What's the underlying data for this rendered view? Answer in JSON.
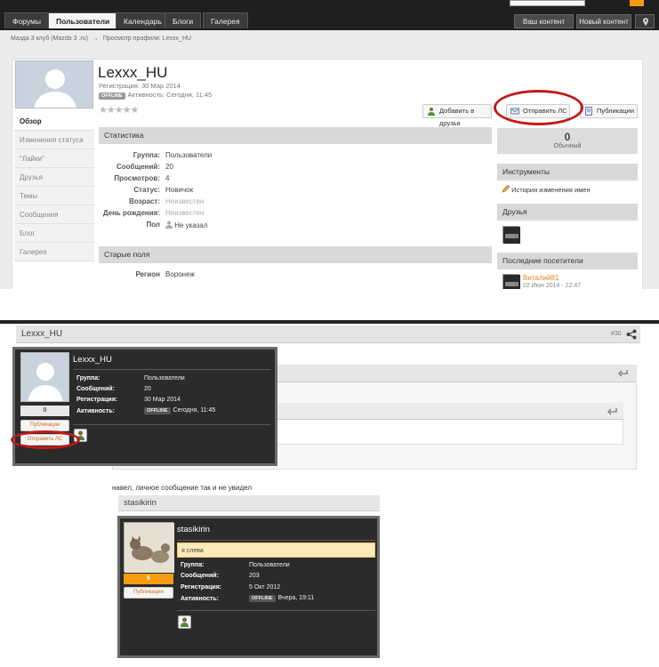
{
  "shot1": {
    "nav": {
      "tabs": [
        "Форумы",
        "Пользователи",
        "Календарь",
        "Блоги",
        "Галерея"
      ],
      "active_index": 1,
      "right_buttons": [
        "Ваш контент",
        "Новый контент"
      ]
    },
    "breadcrumb": {
      "site": "Мазда 3 клуб (Mazda 3 .ru)",
      "sep": "→",
      "page": "Просмотр профиля: Lexxx_HU"
    },
    "profile": {
      "username": "Lexxx_HU",
      "registered": "Регистрация: 30 Мар 2014",
      "status_badge": "OFFLINE",
      "activity": "Активность: Сегодня, 11:45",
      "rating_stars": 5,
      "buttons": {
        "add_friend": "Добавить в друзья",
        "send_pm": "Отправить ЛС",
        "publications": "Публикации"
      }
    },
    "sidebar": [
      "Обзор",
      "Изменения статуса",
      "\"Лайки\"",
      "Друзья",
      "Темы",
      "Сообщения",
      "Блог",
      "Галерея"
    ],
    "stats": {
      "heading": "Статистика",
      "rows": [
        {
          "k": "Группа:",
          "v": "Пользователи"
        },
        {
          "k": "Сообщений:",
          "v": "20"
        },
        {
          "k": "Просмотров:",
          "v": "4"
        },
        {
          "k": "Статус:",
          "v": "Новичок"
        },
        {
          "k": "Возраст:",
          "v": "Неизвестен"
        },
        {
          "k": "День рождения:",
          "v": "Неизвестен"
        },
        {
          "k": "Пол",
          "v": "Не указал"
        }
      ]
    },
    "old_fields": {
      "heading": "Старые поля",
      "region_k": "Регион",
      "region_v": "Воронеж"
    },
    "reputation": {
      "value": "0",
      "label": "Обычный"
    },
    "tools": {
      "heading": "Инструменты",
      "item": "История изменения имен"
    },
    "friends": {
      "heading": "Друзья"
    },
    "visitors": {
      "heading": "Последние посетители",
      "name": "Виталий81",
      "date": "02 Июн 2014 - 22:47"
    }
  },
  "shot2": {
    "post_author": "Lexxx_HU",
    "post_number": "#30",
    "card1": {
      "name": "Lexxx_HU",
      "rep": "0",
      "pub_btn": "Публикации",
      "pm_btn": "Отправить ЛС",
      "rows": [
        {
          "k": "Группа:",
          "v": "Пользователи"
        },
        {
          "k": "Сообщений:",
          "v": "20"
        },
        {
          "k": "Регистрация:",
          "v": "30 Мар 2014"
        },
        {
          "k": "Активность:",
          "badge": "OFFLINE",
          "v": "Сегодня, 11:45"
        }
      ]
    },
    "message_text": "навел, личное сообщение так и не увидел",
    "quote_author": "stasikirin",
    "card2": {
      "name": "stasikirin",
      "status_text": "я слева",
      "rep": "6",
      "pub_btn": "Публикации",
      "rows": [
        {
          "k": "Группа:",
          "v": "Пользователи"
        },
        {
          "k": "Сообщений:",
          "v": "203"
        },
        {
          "k": "Регистрация:",
          "v": "5 Окт 2012"
        },
        {
          "k": "Активность:",
          "badge": "OFFLINE",
          "v": "Вчера, 19:11"
        }
      ]
    }
  },
  "colors": {
    "accent_orange": "#f39c12",
    "highlight_red": "#c21a1a",
    "dark_card": "#2b2b2b"
  }
}
